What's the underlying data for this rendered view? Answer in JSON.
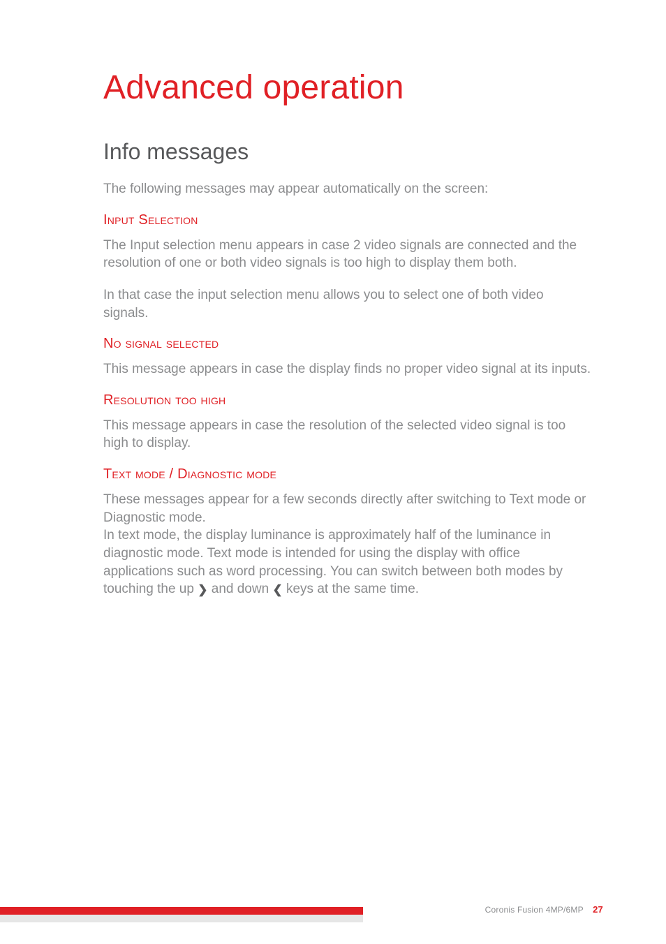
{
  "title": "Advanced operation",
  "section_heading": "Info messages",
  "intro": "The following messages may appear automatically on the screen:",
  "blocks": {
    "input_selection": {
      "heading": "Input Selection",
      "p1": "The Input selection menu appears in case 2 video signals are connected and the resolution of one or both video signals is too high to display them both.",
      "p2": "In that case the input selection menu allows you to select one of both video signals."
    },
    "no_signal": {
      "heading": "No signal selected",
      "p1": "This message appears in case the display finds no proper video signal at its inputs."
    },
    "res_high": {
      "heading": "Resolution too high",
      "p1": "This message appears in case the resolution of the selected video signal is too high to display."
    },
    "text_mode": {
      "heading": "Text mode / Diagnostic mode",
      "p1": "These messages appear for a few seconds directly after switching to Text mode or Diagnostic mode.",
      "p2a": "In text mode, the display luminance is approximately half of the luminance in diagnostic mode. Text mode is intended for using the display with office applications such as word processing. You can switch between both modes by touching the up ",
      "p2b": " and down ",
      "p2c": " keys at the same time."
    }
  },
  "icons": {
    "up": "❯",
    "down": "❮"
  },
  "footer": {
    "product": "Coronis Fusion 4MP/6MP",
    "page": "27"
  }
}
